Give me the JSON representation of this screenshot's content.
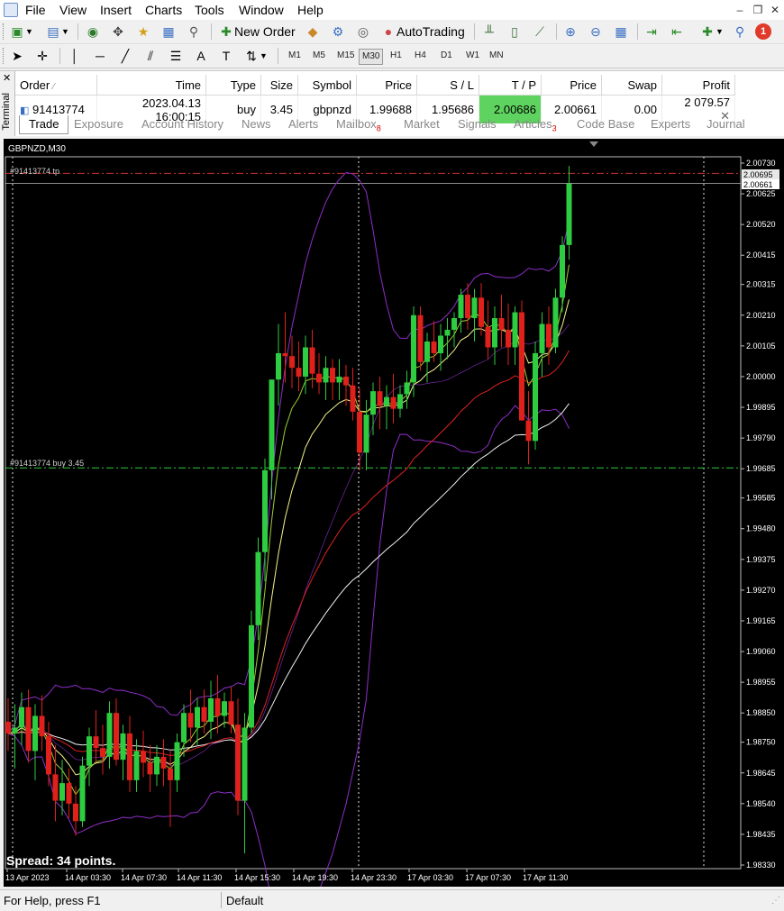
{
  "menu": {
    "items": [
      "File",
      "View",
      "Insert",
      "Charts",
      "Tools",
      "Window",
      "Help"
    ]
  },
  "toolbar": {
    "new_order": "New Order",
    "autotrading": "AutoTrading",
    "notification_count": "1"
  },
  "timeframes": [
    "M1",
    "M5",
    "M15",
    "M30",
    "H1",
    "H4",
    "D1",
    "W1",
    "MN"
  ],
  "active_timeframe": "M30",
  "terminal": {
    "label": "Terminal",
    "columns": [
      "Order",
      "Time",
      "Type",
      "Size",
      "Symbol",
      "Price",
      "S / L",
      "T / P",
      "Price",
      "Swap",
      "Profit"
    ],
    "row": {
      "order": "91413774",
      "time": "2023.04.13 16:00:15",
      "type": "buy",
      "size": "3.45",
      "symbol": "gbpnzd",
      "price": "1.99688",
      "sl": "1.95686",
      "tp": "2.00686",
      "current_price": "2.00661",
      "swap": "0.00",
      "profit": "2 079.57"
    },
    "tabs": [
      {
        "label": "Trade"
      },
      {
        "label": "Exposure"
      },
      {
        "label": "Account History"
      },
      {
        "label": "News"
      },
      {
        "label": "Alerts"
      },
      {
        "label": "Mailbox",
        "badge": "8"
      },
      {
        "label": "Market"
      },
      {
        "label": "Signals"
      },
      {
        "label": "Articles",
        "badge": "3"
      },
      {
        "label": "Code Base"
      },
      {
        "label": "Experts"
      },
      {
        "label": "Journal"
      }
    ]
  },
  "chart": {
    "symbol_label": "GBPNZD,M30",
    "tp_label": "#91413774 tp",
    "buy_label": "#91413774 buy 3.45",
    "spread": "Spread: 34 points.",
    "price_scale": [
      "2.00730",
      "2.00625",
      "2.00520",
      "2.00415",
      "2.00315",
      "2.00210",
      "2.00105",
      "2.00000",
      "1.99895",
      "1.99790",
      "1.99685",
      "1.99585",
      "1.99480",
      "1.99375",
      "1.99270",
      "1.99165",
      "1.99060",
      "1.98955",
      "1.98850",
      "1.98750",
      "1.98645",
      "1.98540",
      "1.98435",
      "1.98330"
    ],
    "price_ticks": [
      2.0073,
      2.00625,
      2.0052,
      2.00415,
      2.00315,
      2.0021,
      2.00105,
      2.0,
      1.99895,
      1.9979,
      1.99685,
      1.99585,
      1.9948,
      1.99375,
      1.9927,
      1.99165,
      1.9906,
      1.98955,
      1.9885,
      1.9875,
      1.98645,
      1.9854,
      1.98435,
      1.9833
    ],
    "tp_price": "2.00695",
    "current_price": "2.00661",
    "time_labels": [
      "13 Apr 2023",
      "14 Apr 03:30",
      "14 Apr 07:30",
      "14 Apr 11:30",
      "14 Apr 15:30",
      "14 Apr 19:30",
      "14 Apr 23:30",
      "17 Apr 03:30",
      "17 Apr 07:30",
      "17 Apr 11:30"
    ],
    "colors": {
      "bull": "#2ecc40",
      "bear": "#e0201a",
      "bb": "#8e2ec8",
      "ma_fast": "#9acd32",
      "ma_yellow": "#f5f58c",
      "ma_red": "#dd2222",
      "ma_white": "#f0f0f0"
    }
  },
  "chart_data": {
    "type": "candlestick",
    "symbol": "GBPNZD",
    "timeframe": "M30",
    "ylim": [
      1.9833,
      2.0073
    ],
    "candles": [
      {
        "o": 1.9882,
        "h": 1.989,
        "l": 1.9872,
        "c": 1.9878
      },
      {
        "o": 1.9878,
        "h": 1.9888,
        "l": 1.9866,
        "c": 1.988
      },
      {
        "o": 1.988,
        "h": 1.9892,
        "l": 1.9874,
        "c": 1.9887
      },
      {
        "o": 1.9887,
        "h": 1.9893,
        "l": 1.9868,
        "c": 1.9872
      },
      {
        "o": 1.9872,
        "h": 1.9888,
        "l": 1.9862,
        "c": 1.9884
      },
      {
        "o": 1.9884,
        "h": 1.9891,
        "l": 1.9872,
        "c": 1.9877
      },
      {
        "o": 1.9877,
        "h": 1.9882,
        "l": 1.986,
        "c": 1.9864
      },
      {
        "o": 1.9864,
        "h": 1.9874,
        "l": 1.9848,
        "c": 1.9855
      },
      {
        "o": 1.9855,
        "h": 1.9869,
        "l": 1.985,
        "c": 1.9861
      },
      {
        "o": 1.9861,
        "h": 1.9866,
        "l": 1.9849,
        "c": 1.9854
      },
      {
        "o": 1.9854,
        "h": 1.986,
        "l": 1.9843,
        "c": 1.9848
      },
      {
        "o": 1.9848,
        "h": 1.987,
        "l": 1.9846,
        "c": 1.9867
      },
      {
        "o": 1.9867,
        "h": 1.988,
        "l": 1.986,
        "c": 1.9877
      },
      {
        "o": 1.9877,
        "h": 1.9886,
        "l": 1.9868,
        "c": 1.9873
      },
      {
        "o": 1.9873,
        "h": 1.9881,
        "l": 1.9864,
        "c": 1.987
      },
      {
        "o": 1.987,
        "h": 1.9889,
        "l": 1.9866,
        "c": 1.9885
      },
      {
        "o": 1.9885,
        "h": 1.989,
        "l": 1.9867,
        "c": 1.9869
      },
      {
        "o": 1.9869,
        "h": 1.9881,
        "l": 1.9862,
        "c": 1.9878
      },
      {
        "o": 1.9878,
        "h": 1.9884,
        "l": 1.9858,
        "c": 1.9862
      },
      {
        "o": 1.9862,
        "h": 1.9876,
        "l": 1.9858,
        "c": 1.9872
      },
      {
        "o": 1.9872,
        "h": 1.9879,
        "l": 1.9863,
        "c": 1.9868
      },
      {
        "o": 1.9868,
        "h": 1.9874,
        "l": 1.9858,
        "c": 1.9864
      },
      {
        "o": 1.9864,
        "h": 1.9874,
        "l": 1.986,
        "c": 1.987
      },
      {
        "o": 1.987,
        "h": 1.9876,
        "l": 1.986,
        "c": 1.9866
      },
      {
        "o": 1.9866,
        "h": 1.9872,
        "l": 1.9846,
        "c": 1.9862
      },
      {
        "o": 1.9862,
        "h": 1.9878,
        "l": 1.9858,
        "c": 1.9875
      },
      {
        "o": 1.9875,
        "h": 1.9888,
        "l": 1.987,
        "c": 1.9885
      },
      {
        "o": 1.9885,
        "h": 1.9893,
        "l": 1.9875,
        "c": 1.988
      },
      {
        "o": 1.988,
        "h": 1.989,
        "l": 1.9874,
        "c": 1.9887
      },
      {
        "o": 1.9887,
        "h": 1.9893,
        "l": 1.9878,
        "c": 1.9882
      },
      {
        "o": 1.9882,
        "h": 1.9896,
        "l": 1.9876,
        "c": 1.989
      },
      {
        "o": 1.989,
        "h": 1.9898,
        "l": 1.9878,
        "c": 1.9884
      },
      {
        "o": 1.9884,
        "h": 1.9892,
        "l": 1.988,
        "c": 1.9889
      },
      {
        "o": 1.9889,
        "h": 1.9894,
        "l": 1.9878,
        "c": 1.9881
      },
      {
        "o": 1.9881,
        "h": 1.989,
        "l": 1.985,
        "c": 1.9855
      },
      {
        "o": 1.9855,
        "h": 1.9885,
        "l": 1.9837,
        "c": 1.988
      },
      {
        "o": 1.988,
        "h": 1.992,
        "l": 1.9878,
        "c": 1.9915
      },
      {
        "o": 1.9915,
        "h": 1.9945,
        "l": 1.991,
        "c": 1.994
      },
      {
        "o": 1.994,
        "h": 1.9972,
        "l": 1.993,
        "c": 1.9968
      },
      {
        "o": 1.9968,
        "h": 1.9985,
        "l": 1.9958,
        "c": 1.9999
      },
      {
        "o": 1.9999,
        "h": 2.0018,
        "l": 1.999,
        "c": 2.0008
      },
      {
        "o": 2.0008,
        "h": 2.0022,
        "l": 1.9998,
        "c": 2.0007
      },
      {
        "o": 2.0007,
        "h": 2.0014,
        "l": 1.9996,
        "c": 2.0003
      },
      {
        "o": 2.0003,
        "h": 2.0012,
        "l": 1.9995,
        "c": 2.0
      },
      {
        "o": 2.0,
        "h": 2.0014,
        "l": 1.9994,
        "c": 2.001
      },
      {
        "o": 2.001,
        "h": 2.0016,
        "l": 1.9996,
        "c": 2.0001
      },
      {
        "o": 2.0001,
        "h": 2.0008,
        "l": 1.9994,
        "c": 1.9998
      },
      {
        "o": 1.9998,
        "h": 2.0007,
        "l": 1.9992,
        "c": 2.0003
      },
      {
        "o": 2.0003,
        "h": 2.0006,
        "l": 1.9992,
        "c": 1.9998
      },
      {
        "o": 1.9998,
        "h": 2.0006,
        "l": 1.9992,
        "c": 2.0
      },
      {
        "o": 2.0,
        "h": 2.0004,
        "l": 1.999,
        "c": 1.9997
      },
      {
        "o": 1.9997,
        "h": 2.0003,
        "l": 1.9985,
        "c": 1.9988
      },
      {
        "o": 1.9988,
        "h": 1.9996,
        "l": 1.9968,
        "c": 1.9974
      },
      {
        "o": 1.9974,
        "h": 1.9992,
        "l": 1.9968,
        "c": 1.9987
      },
      {
        "o": 1.9987,
        "h": 1.9998,
        "l": 1.998,
        "c": 1.9995
      },
      {
        "o": 1.9995,
        "h": 2.0,
        "l": 1.9982,
        "c": 1.999
      },
      {
        "o": 1.999,
        "h": 1.9997,
        "l": 1.9982,
        "c": 1.9993
      },
      {
        "o": 1.9993,
        "h": 2.0001,
        "l": 1.9984,
        "c": 1.9989
      },
      {
        "o": 1.9989,
        "h": 1.9997,
        "l": 1.9986,
        "c": 1.9994
      },
      {
        "o": 1.9994,
        "h": 2.0002,
        "l": 1.9989,
        "c": 1.9998
      },
      {
        "o": 1.9998,
        "h": 2.0024,
        "l": 1.9993,
        "c": 2.0021
      },
      {
        "o": 2.0021,
        "h": 2.0024,
        "l": 2.0002,
        "c": 2.0005
      },
      {
        "o": 2.0005,
        "h": 2.0015,
        "l": 1.9998,
        "c": 2.0012
      },
      {
        "o": 2.0012,
        "h": 2.0019,
        "l": 2.0005,
        "c": 2.0008
      },
      {
        "o": 2.0008,
        "h": 2.0018,
        "l": 2.0002,
        "c": 2.0014
      },
      {
        "o": 2.0014,
        "h": 2.002,
        "l": 2.0006,
        "c": 2.0016
      },
      {
        "o": 2.0016,
        "h": 2.0022,
        "l": 2.001,
        "c": 2.002
      },
      {
        "o": 2.002,
        "h": 2.003,
        "l": 2.0015,
        "c": 2.0028
      },
      {
        "o": 2.0028,
        "h": 2.0032,
        "l": 2.0016,
        "c": 2.002
      },
      {
        "o": 2.002,
        "h": 2.003,
        "l": 2.0012,
        "c": 2.0027
      },
      {
        "o": 2.0027,
        "h": 2.0032,
        "l": 2.0014,
        "c": 2.0017
      },
      {
        "o": 2.0017,
        "h": 2.0026,
        "l": 2.0006,
        "c": 2.001
      },
      {
        "o": 2.001,
        "h": 2.0024,
        "l": 2.0004,
        "c": 2.002
      },
      {
        "o": 2.002,
        "h": 2.0028,
        "l": 2.001,
        "c": 2.0016
      },
      {
        "o": 2.0016,
        "h": 2.0025,
        "l": 2.0004,
        "c": 2.001
      },
      {
        "o": 2.001,
        "h": 2.0024,
        "l": 2.0004,
        "c": 2.0022
      },
      {
        "o": 2.0022,
        "h": 2.0026,
        "l": 1.9985,
        "c": 1.9985
      },
      {
        "o": 1.9985,
        "h": 1.9995,
        "l": 1.997,
        "c": 1.9978
      },
      {
        "o": 1.9978,
        "h": 2.0012,
        "l": 1.9975,
        "c": 2.0008
      },
      {
        "o": 2.0008,
        "h": 2.0022,
        "l": 2.0,
        "c": 2.0018
      },
      {
        "o": 2.0018,
        "h": 2.0024,
        "l": 2.0004,
        "c": 2.001
      },
      {
        "o": 2.001,
        "h": 2.003,
        "l": 2.0008,
        "c": 2.0027
      },
      {
        "o": 2.0027,
        "h": 2.0048,
        "l": 2.0022,
        "c": 2.0045
      },
      {
        "o": 2.0045,
        "h": 2.0072,
        "l": 2.004,
        "c": 2.0066
      }
    ]
  }
}
